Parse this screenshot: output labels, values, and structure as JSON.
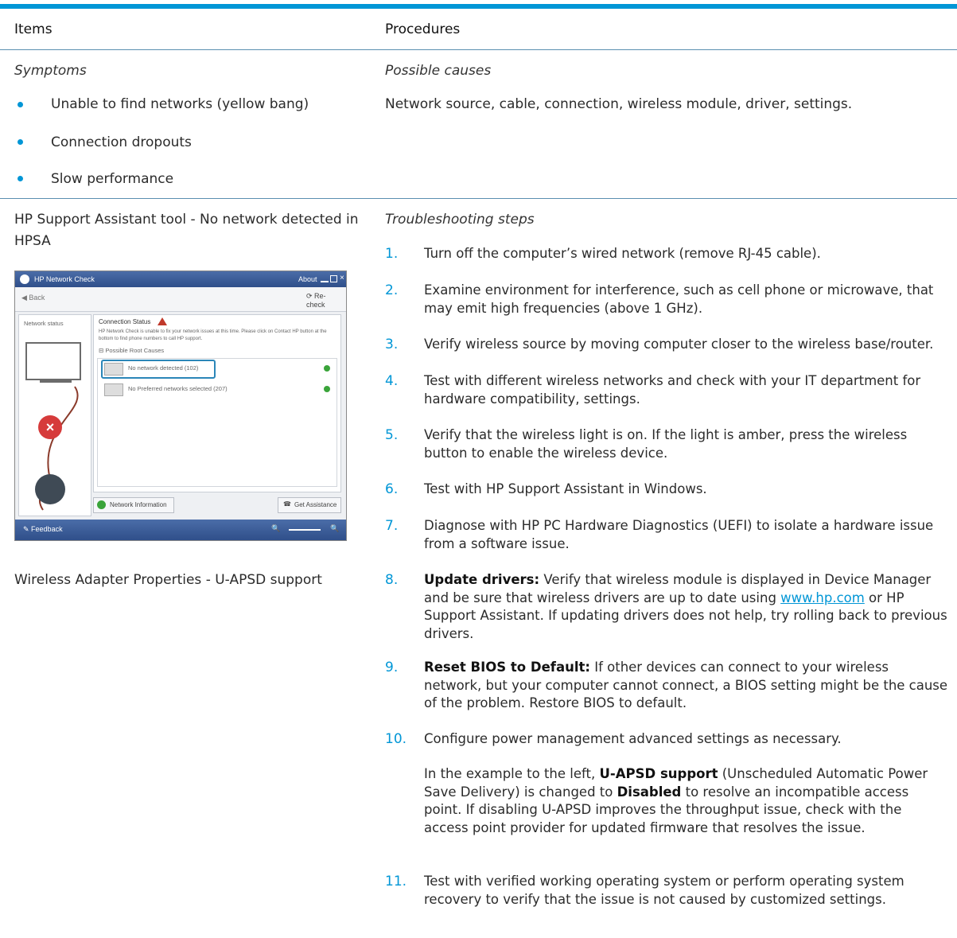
{
  "header": {
    "items": "Items",
    "procedures": "Procedures"
  },
  "colors": {
    "accent": "#0096d6",
    "rule": "#5a8fb0"
  },
  "row1": {
    "symptoms_label": "Symptoms",
    "symptoms": [
      "Unable to find networks (yellow bang)",
      "Connection dropouts",
      "Slow performance"
    ],
    "causes_label": "Possible causes",
    "causes": "Network source, cable, connection, wireless module, driver, settings."
  },
  "row2": {
    "left_title_line1": "HP Support Assistant tool - No network detected in",
    "left_title_line2": "HPSA",
    "left_caption": "Wireless Adapter Properties - U-APSD support",
    "steps_label": "Troubleshooting steps",
    "steps": [
      {
        "num": "1.",
        "text": "Turn off the computer’s wired network (remove RJ-45 cable)."
      },
      {
        "num": "2.",
        "text": "Examine environment for interference, such as cell phone or microwave, that may emit high frequencies (above 1 GHz)."
      },
      {
        "num": "3.",
        "text": "Verify wireless source by moving computer closer to the wireless base/router."
      },
      {
        "num": "4.",
        "text": "Test with different wireless networks and check with your IT department for hardware compatibility, settings."
      },
      {
        "num": "5.",
        "text": "Verify that the wireless light is on. If the light is amber, press the wireless button to enable the wireless device."
      },
      {
        "num": "6.",
        "text": "Test with HP Support Assistant in Windows."
      },
      {
        "num": "7.",
        "text": "Diagnose with HP PC Hardware Diagnostics (UEFI) to isolate a hardware issue from a software issue."
      },
      {
        "num": "8.",
        "bold": "Update drivers:",
        "pre": " Verify that wireless module is displayed in Device Manager and be sure that wireless drivers are up to date using ",
        "link": "www.hp.com",
        "post": " or HP Support Assistant. If updating drivers does not help, try rolling back to previous drivers."
      },
      {
        "num": "9.",
        "bold": "Reset BIOS to Default:",
        "pre": " If other devices can connect to your wireless network, but your computer cannot connect, a BIOS setting might be the cause of the problem. Restore BIOS to default."
      },
      {
        "num": "10.",
        "text": "Configure power management advanced settings as necessary."
      },
      {
        "num": "11.",
        "text": "Test with verified working operating system or perform operating system recovery to verify that the issue is not caused by customized settings."
      }
    ],
    "step10_note": {
      "p1": "In the example to the left, ",
      "b1": "U-APSD support",
      "p2": " (Unscheduled Automatic Power Save Delivery) is changed to ",
      "b2": "Disabled",
      "p3": " to resolve an incompatible access point. If disabling U-APSD improves the throughput issue, check with the access point provider for updated firmware that resolves the issue."
    }
  },
  "screenshot": {
    "title": "HP Network Check",
    "about": "About",
    "back": "Back",
    "recheck": "Re-check",
    "side_label": "Network status",
    "status_title": "Connection Status",
    "status_msg": "HP Network Check is unable to fix your network issues at this time. Please click on Contact HP button at the bottom to find phone numbers to call HP support.",
    "causes_header": "Possible Root Causes",
    "cause1": "No network detected (102)",
    "cause2": "No Preferred networks selected (207)",
    "network_info": "Network Information",
    "get_assistance": "Get Assistance",
    "feedback": "Feedback"
  }
}
